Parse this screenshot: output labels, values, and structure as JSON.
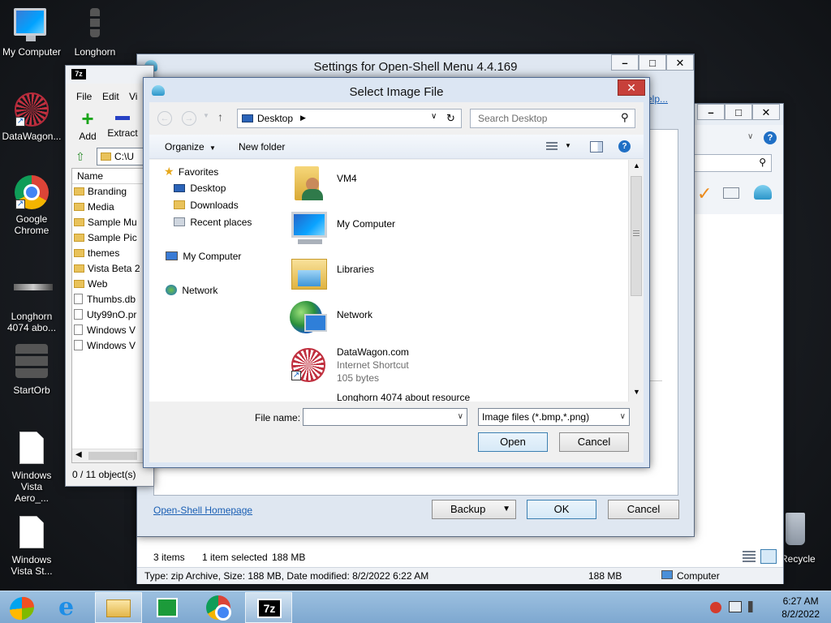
{
  "desktop": {
    "icons": [
      {
        "label": "My Computer"
      },
      {
        "label": "Longhorn Resource Lab"
      },
      {
        "label": "DataWagon..."
      },
      {
        "label": "Google Chrome"
      },
      {
        "label": "Longhorn 4074 abo..."
      },
      {
        "label": "StartOrb"
      },
      {
        "label": "Windows Vista Aero_..."
      },
      {
        "label": "Windows Vista St..."
      },
      {
        "label": "Recycle Bin"
      }
    ]
  },
  "explorer": {
    "status_items": "3 items",
    "status_selected": "1 item selected",
    "status_size": "188 MB",
    "details": "Type: zip Archive, Size: 188 MB, Date modified: 8/2/2022 6:22 AM",
    "details_size": "188 MB",
    "details_location": "Computer"
  },
  "sevenzip": {
    "menu": [
      "File",
      "Edit",
      "Vi"
    ],
    "tools": [
      "Add",
      "Extract"
    ],
    "path": "C:\\U",
    "column": "Name",
    "rows": [
      {
        "name": "Branding",
        "kind": "folder"
      },
      {
        "name": "Media",
        "kind": "folder"
      },
      {
        "name": "Sample Mu",
        "kind": "folder"
      },
      {
        "name": "Sample Pic",
        "kind": "folder"
      },
      {
        "name": "themes",
        "kind": "folder"
      },
      {
        "name": "Vista Beta 2",
        "kind": "folder"
      },
      {
        "name": "Web",
        "kind": "folder"
      },
      {
        "name": "Thumbs.db",
        "kind": "file"
      },
      {
        "name": "Uty99nO.pr",
        "kind": "file"
      },
      {
        "name": "Windows V",
        "kind": "file"
      },
      {
        "name": "Windows V",
        "kind": "file"
      }
    ],
    "status": "0 / 11 object(s)"
  },
  "settings": {
    "title": "Settings for Open-Shell Menu 4.4.169",
    "help_link": "elp...",
    "homepage_link": "Open-Shell Homepage",
    "backup_label": "Backup",
    "ok_label": "OK",
    "cancel_label": "Cancel"
  },
  "dialog": {
    "title": "Select Image File",
    "address": "Desktop",
    "search_placeholder": "Search Desktop",
    "organize_label": "Organize",
    "new_folder_label": "New folder",
    "nav": {
      "favorites": "Favorites",
      "desktop": "Desktop",
      "downloads": "Downloads",
      "recent": "Recent places",
      "computer": "My Computer",
      "network": "Network"
    },
    "items": [
      {
        "name": "VM4",
        "sub1": "",
        "sub2": ""
      },
      {
        "name": "My Computer",
        "sub1": "",
        "sub2": ""
      },
      {
        "name": "Libraries",
        "sub1": "",
        "sub2": ""
      },
      {
        "name": "Network",
        "sub1": "",
        "sub2": ""
      },
      {
        "name": "DataWagon.com",
        "sub1": "Internet Shortcut",
        "sub2": "105 bytes"
      },
      {
        "name": "Longhorn 4074 about resource",
        "sub1": "",
        "sub2": ""
      }
    ],
    "filename_label": "File name:",
    "filename_value": "",
    "filetype": "Image files (*.bmp,*.png)",
    "open_label": "Open",
    "cancel_label": "Cancel"
  },
  "taskbar": {
    "time": "6:27 AM",
    "date": "8/2/2022",
    "sevenzip_label": "7z"
  }
}
